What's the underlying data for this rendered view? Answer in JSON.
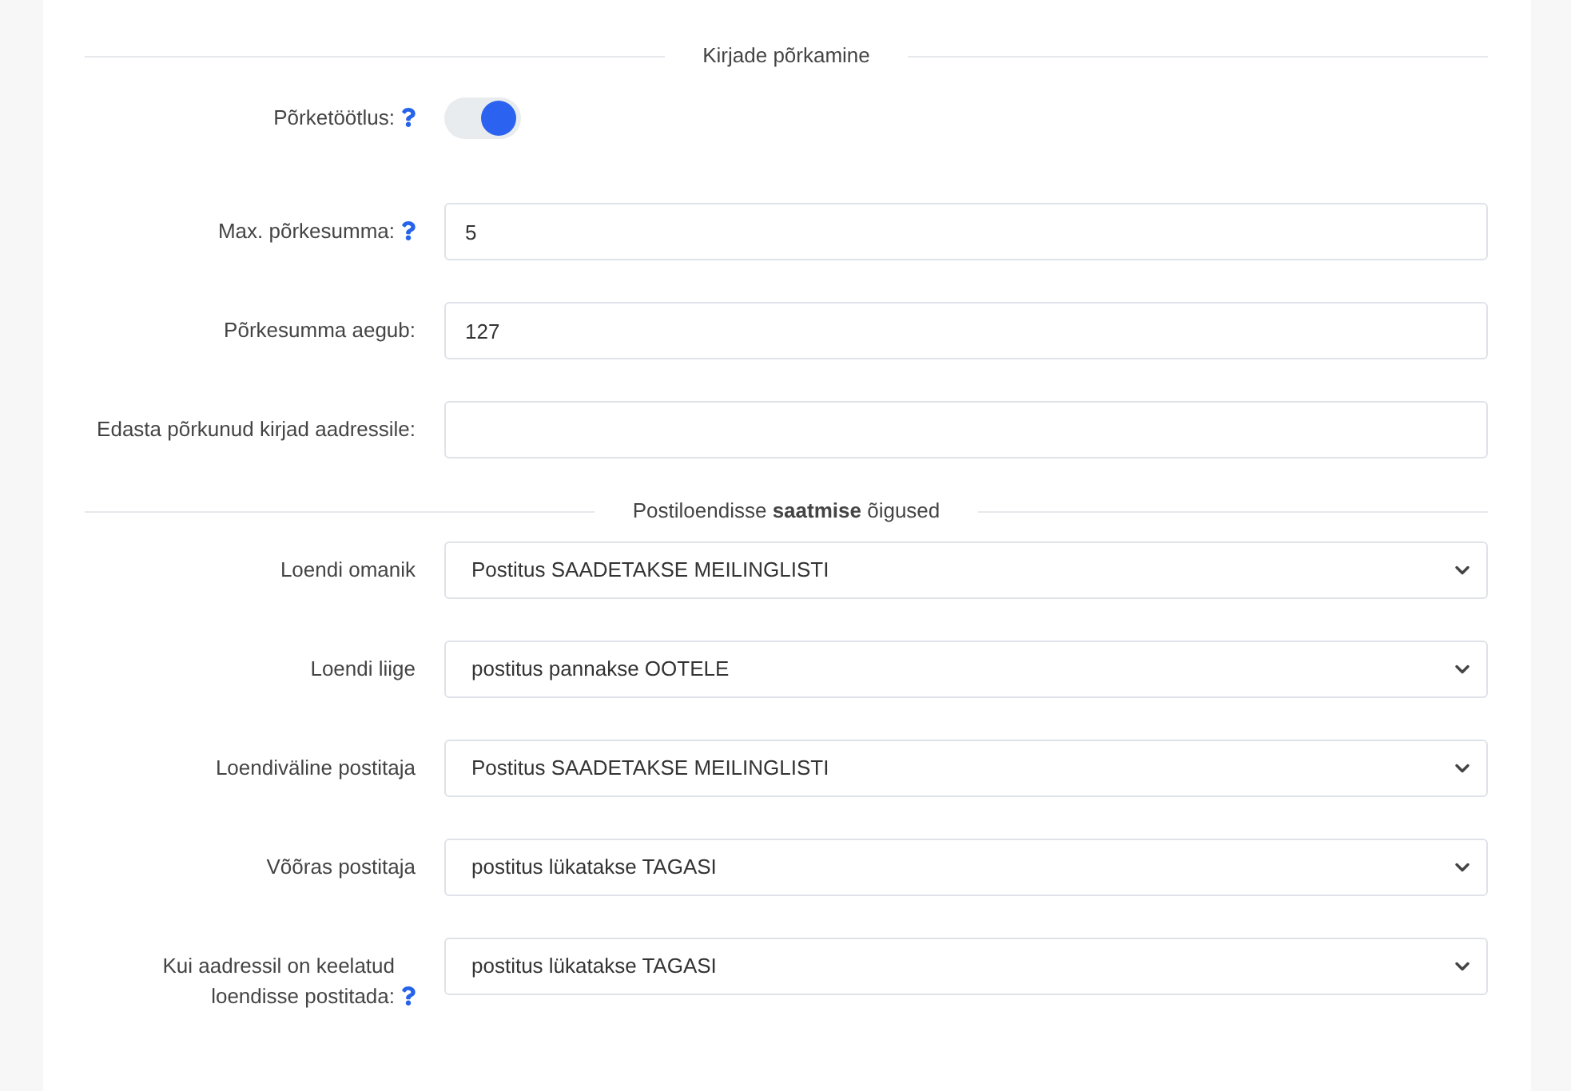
{
  "sections": [
    {
      "title": "Kirjade põrkamine",
      "fields": [
        {
          "kind": "toggle",
          "label": "Põrketöötlus:",
          "help": true,
          "on": true
        },
        {
          "kind": "text",
          "label": "Max. põrkesumma:",
          "help": true,
          "value": "5"
        },
        {
          "kind": "text",
          "label": "Põrkesumma aegub:",
          "help": false,
          "value": "127"
        },
        {
          "kind": "text",
          "label": "Edasta põrkunud kirjad aadressile:",
          "help": false
        }
      ]
    },
    {
      "title": "Postiloendisse **saatmise** õigused",
      "fields": [
        {
          "kind": "select",
          "label": "Loendi omanik",
          "help": false,
          "value": "Postitus SAADETAKSE MEILINGLISTI"
        },
        {
          "kind": "select",
          "label": "Loendi liige",
          "help": false,
          "value": "postitus pannakse OOTELE"
        },
        {
          "kind": "select",
          "label": "Loendiväline postitaja",
          "help": false,
          "value": "Postitus SAADETAKSE MEILINGLISTI"
        },
        {
          "kind": "select",
          "label": "Võõras postitaja",
          "help": false,
          "value": "postitus lükatakse TAGASI"
        },
        {
          "kind": "select",
          "label": "Kui aadressil on keelatud loendisse postitada:",
          "help": true,
          "value": "postitus lükatakse TAGASI"
        }
      ]
    }
  ]
}
